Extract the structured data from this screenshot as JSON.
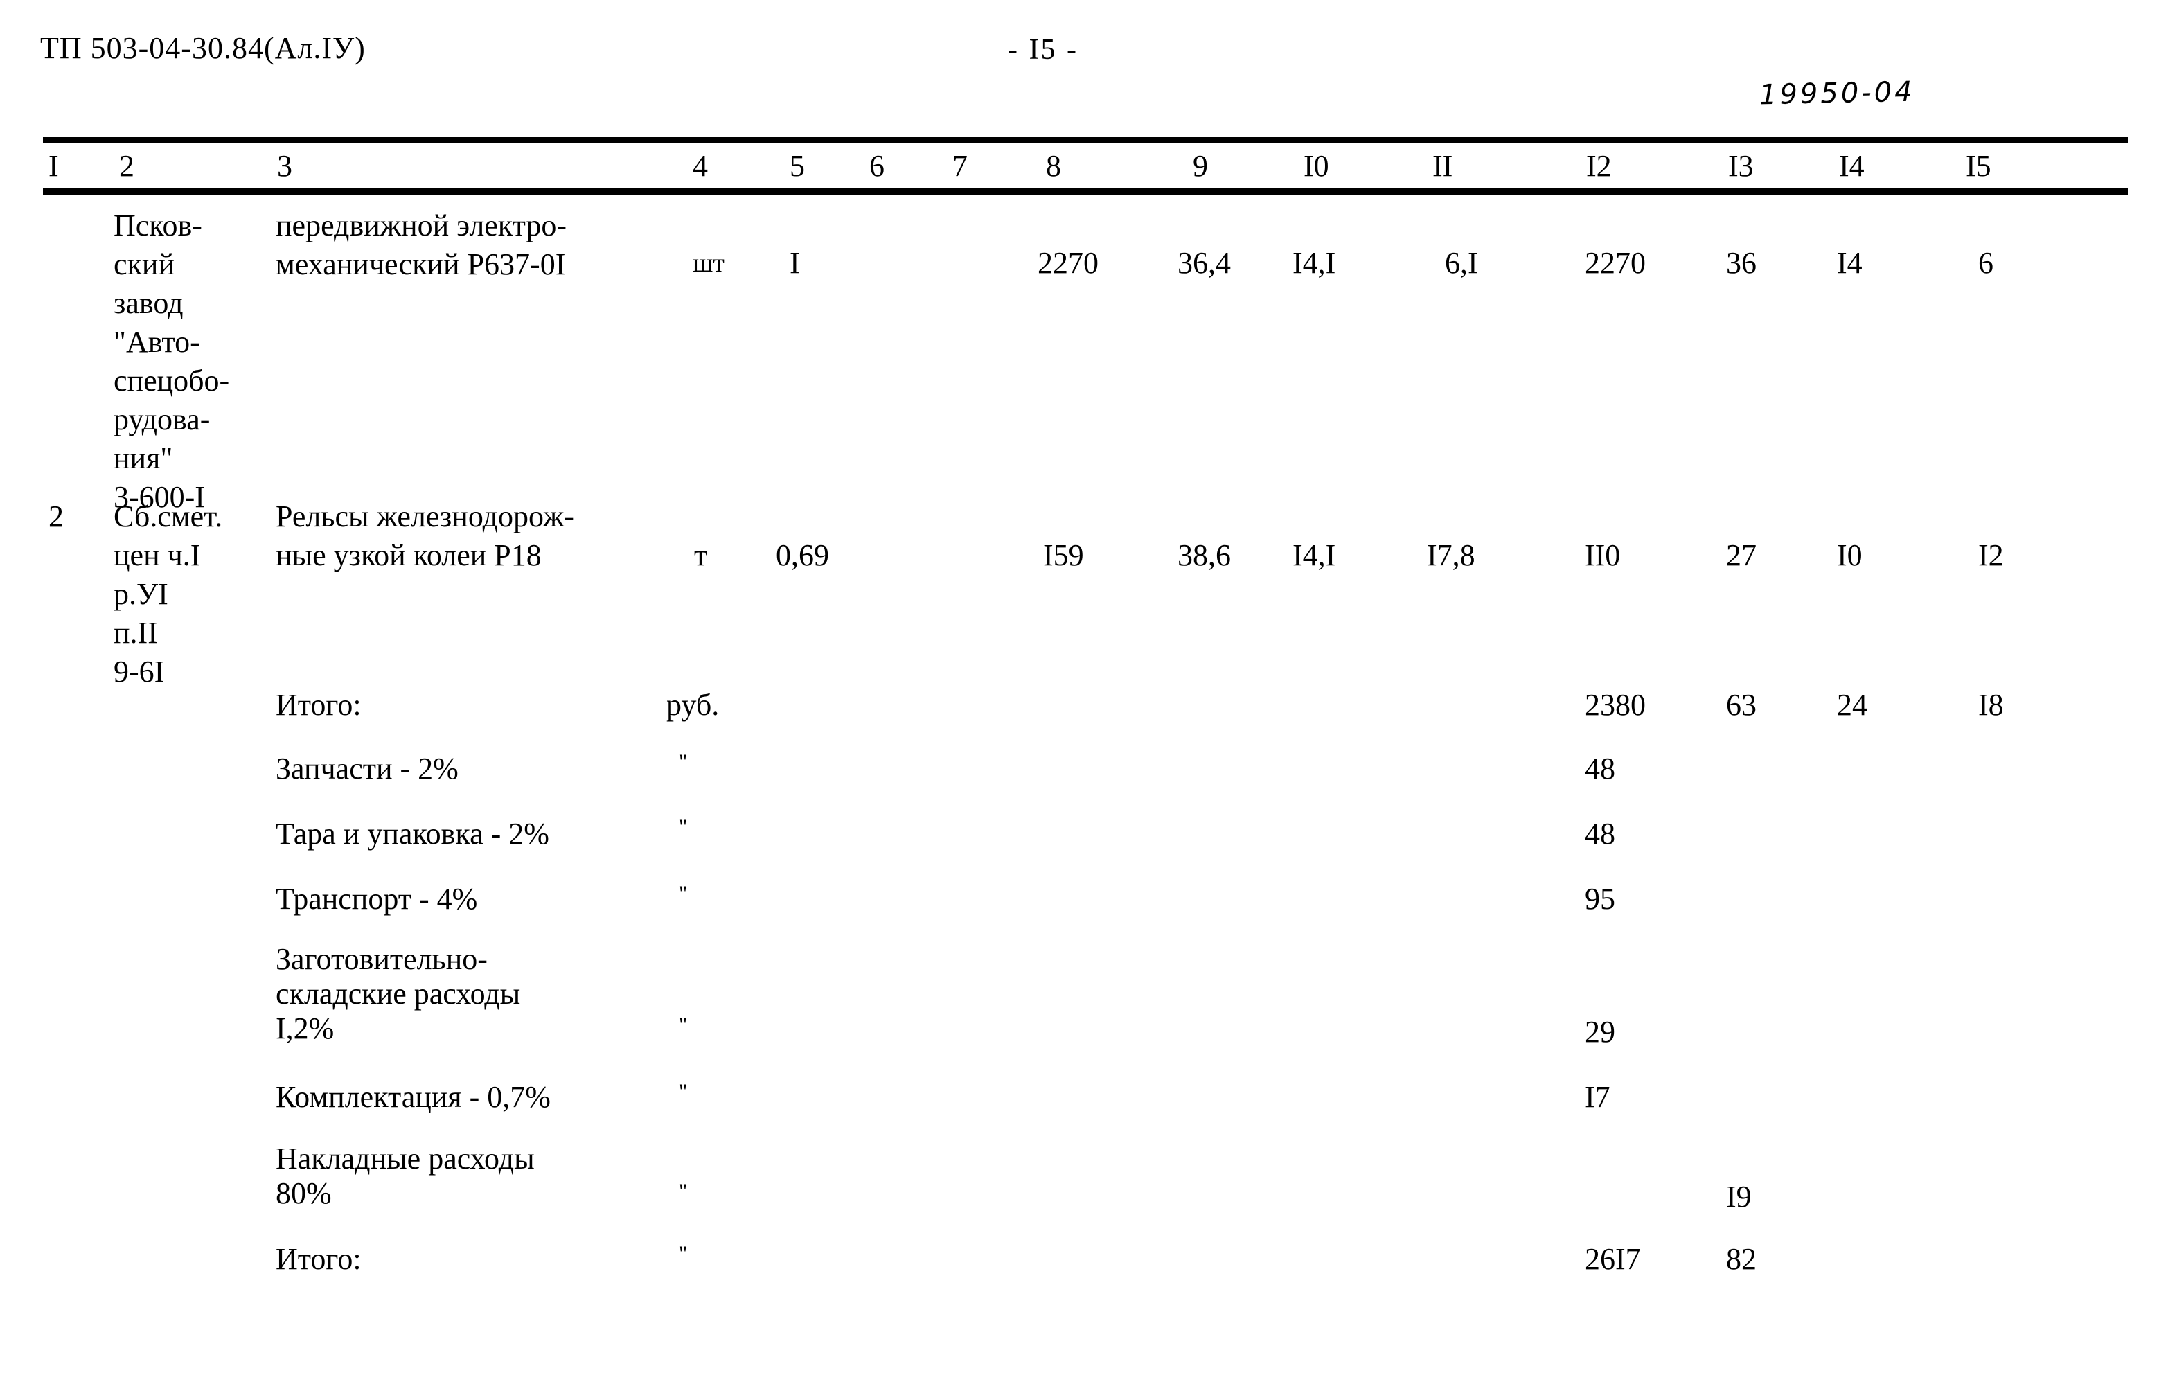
{
  "header": {
    "doc_code": "ТП 503-04-30.84(Ал.IУ)",
    "page_number": "- I5 -",
    "stamp_number": "19950-04"
  },
  "table": {
    "column_headers": [
      "I",
      "2",
      "3",
      "4",
      "5",
      "6",
      "7",
      "8",
      "9",
      "I0",
      "II",
      "I2",
      "I3",
      "I4",
      "I5"
    ],
    "rows": [
      {
        "c1": "",
        "c2": "Псков-\nский\nзавод\n\"Авто-\nспецобо-\nрудова-\nния\"\n3-600-I",
        "c3": "передвижной электро-\nмеханический Р637-0I",
        "c4": "шт",
        "c5": "I",
        "c6": "",
        "c7": "",
        "c8": "2270",
        "c9": "36,4",
        "c10": "I4,I",
        "c11": "6,I",
        "c12": "2270",
        "c13": "36",
        "c14": "I4",
        "c15": "6"
      },
      {
        "c1": "2",
        "c2": "Сб.смет.\nцен ч.I\nр.УI\nп.II\n9-6I",
        "c3": "Рельсы железнодорож-\nные узкой колеи Р18",
        "c4": "т",
        "c5": "0,69",
        "c6": "",
        "c7": "",
        "c8": "I59",
        "c9": "38,6",
        "c10": "I4,I",
        "c11": "I7,8",
        "c12": "II0",
        "c13": "27",
        "c14": "I0",
        "c15": "I2"
      }
    ],
    "summary_rows": [
      {
        "label": "Итого:",
        "unit": "руб.",
        "c12": "2380",
        "c13": "63",
        "c14": "24",
        "c15": "I8"
      },
      {
        "label": "Запчасти - 2%",
        "unit": "\"",
        "c12": "48",
        "c13": "",
        "c14": "",
        "c15": ""
      },
      {
        "label": "Тара и упаковка - 2%",
        "unit": "\"",
        "c12": "48",
        "c13": "",
        "c14": "",
        "c15": ""
      },
      {
        "label": "Транспорт - 4%",
        "unit": "\"",
        "c12": "95",
        "c13": "",
        "c14": "",
        "c15": ""
      },
      {
        "label": "Заготовительно-\nскладские расходы\nI,2%",
        "unit": "\"",
        "c12": "29",
        "c13": "",
        "c14": "",
        "c15": ""
      },
      {
        "label": "Комплектация - 0,7%",
        "unit": "\"",
        "c12": "I7",
        "c13": "",
        "c14": "",
        "c15": ""
      },
      {
        "label": "Накладные расходы\n80%",
        "unit": "\"",
        "c12": "",
        "c13": "I9",
        "c14": "",
        "c15": ""
      },
      {
        "label": "Итого:",
        "unit": "\"",
        "c12": "26I7",
        "c13": "82",
        "c14": "",
        "c15": ""
      }
    ]
  }
}
